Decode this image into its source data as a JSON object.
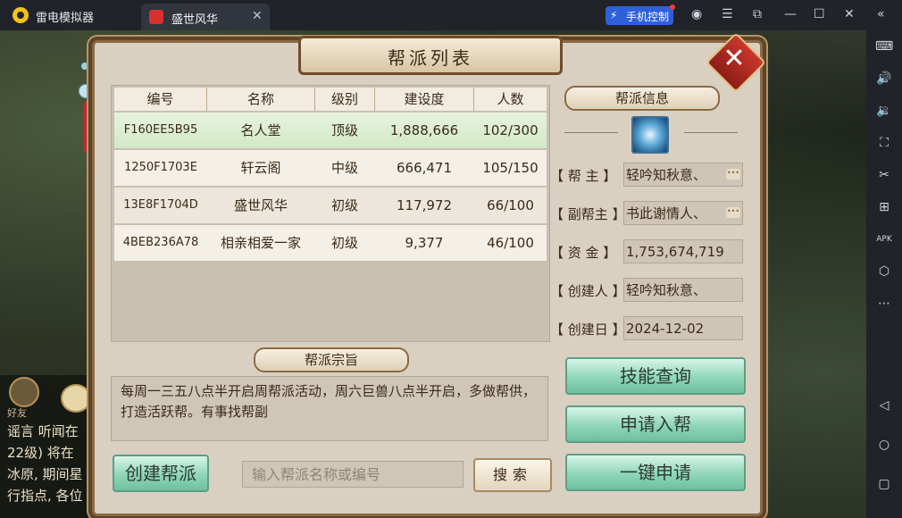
{
  "emulator": {
    "app_name": "雷电模拟器",
    "tab_label": "盛世风华",
    "phone_control_label": "手机控制"
  },
  "chat": {
    "lines": [
      "好友",
      "谣言 听闻在",
      "22级) 将在",
      "冰原, 期间星",
      "行指点, 各位"
    ]
  },
  "panel": {
    "title": "帮派列表",
    "table": {
      "headers": [
        "编号",
        "名称",
        "级别",
        "建设度",
        "人数"
      ],
      "rows": [
        {
          "id": "F160EE5B95",
          "name": "名人堂",
          "level": "顶级",
          "build": "1,888,666",
          "members": "102/300",
          "selected": true
        },
        {
          "id": "1250F1703E",
          "name": "轩云阁",
          "level": "中级",
          "build": "666,471",
          "members": "105/150"
        },
        {
          "id": "13E8F1704D",
          "name": "盛世风华",
          "level": "初级",
          "build": "117,972",
          "members": "66/100"
        },
        {
          "id": "4BEB236A78",
          "name": "相亲相爱一家",
          "level": "初级",
          "build": "9,377",
          "members": "46/100"
        }
      ]
    },
    "info": {
      "title": "帮派信息",
      "leader_label": "【 帮    主 】",
      "leader": "轻吟知秋意、",
      "vice_label": "【 副帮主 】",
      "vice": "书此谢情人、",
      "funds_label": "【 资    金 】",
      "funds": "1,753,674,719",
      "creator_label": "【 创建人 】",
      "creator": "轻吟知秋意、",
      "date_label": "【 创建日 】",
      "date": "2024-12-02"
    },
    "purpose": {
      "title": "帮派宗旨",
      "text": "每周一三五八点半开启周帮派活动，周六巨兽八点半开启，多做帮供，打造活跃帮。有事找帮副"
    },
    "buttons": {
      "skill_query": "技能查询",
      "apply_join": "申请入帮",
      "quick_apply": "一键申请",
      "create": "创建帮派",
      "search": "搜索"
    },
    "search": {
      "placeholder": "输入帮派名称或编号"
    }
  }
}
